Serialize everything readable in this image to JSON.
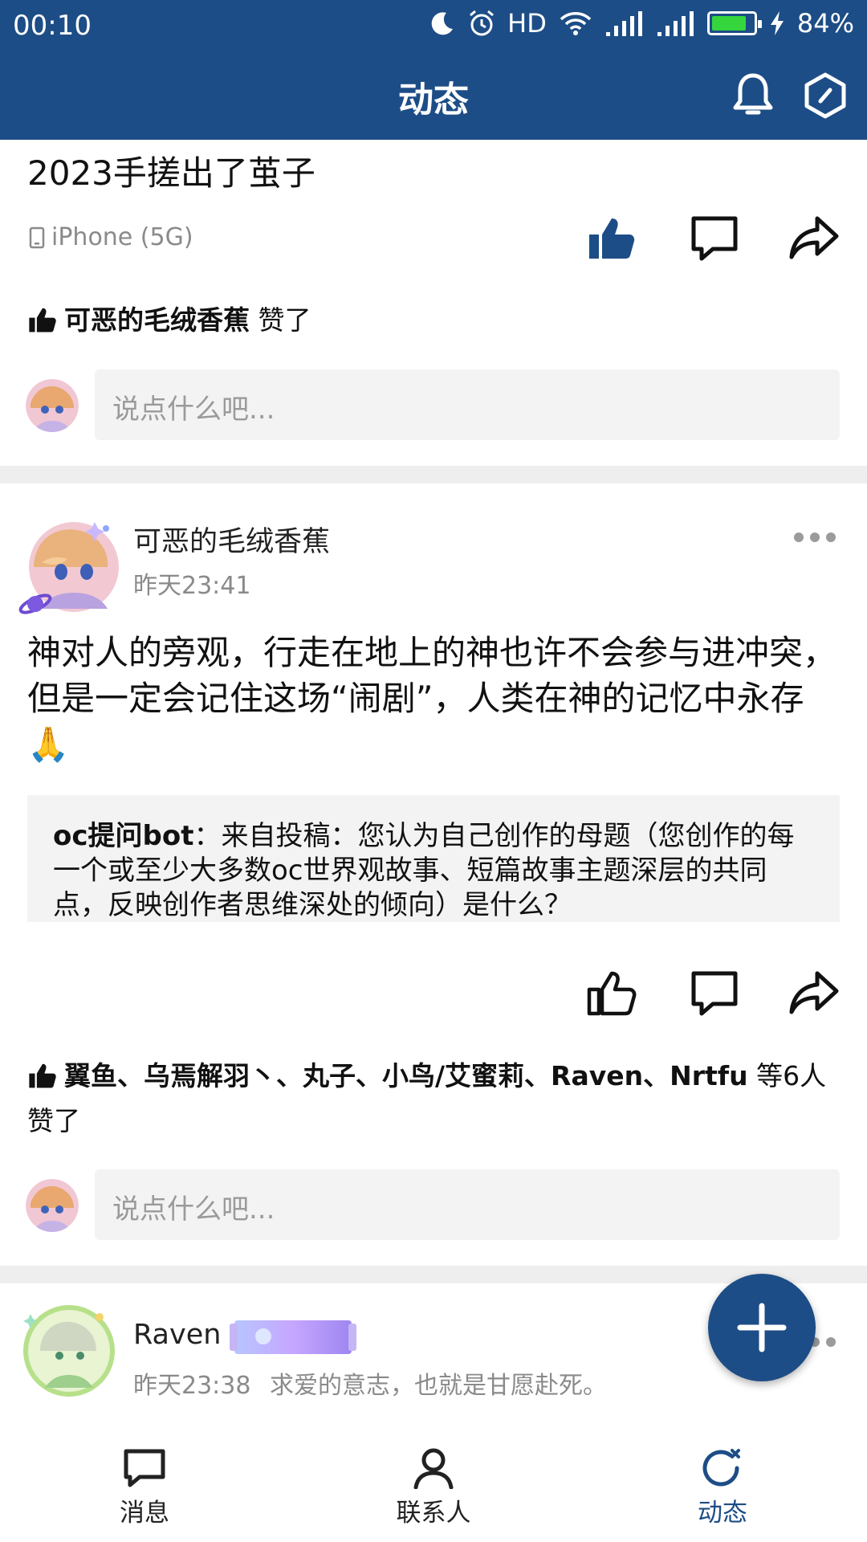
{
  "status_bar": {
    "time": "00:10",
    "network": "HD",
    "battery_percent": "84%",
    "battery_level": 0.84,
    "icons": [
      "moon-icon",
      "alarm-icon",
      "wifi-icon",
      "signal-icon",
      "signal-icon",
      "battery-icon",
      "charging-icon"
    ]
  },
  "header": {
    "title": "动态",
    "bell_icon": "bell-icon",
    "settings_icon": "hexagon-settings-icon"
  },
  "posts": [
    {
      "text": "2023手搓出了茧子",
      "device": "iPhone (5G)",
      "liked": true,
      "likes_names": "可恶的毛绒香蕉",
      "likes_suffix": " 赞了",
      "comment_placeholder": "说点什么吧..."
    },
    {
      "author": "可恶的毛绒香蕉",
      "time": "昨天23:41",
      "text": "神对人的旁观，行走在地上的神也许不会参与进冲突，但是一定会记住这场“闹剧”，人类在神的记忆中永存🙏",
      "quote_author": "oc提问bot",
      "quote_text": "：来自投稿：您认为自己创作的母题（您创作的每一个或至少大多数oc世界观故事、短篇故事主题深层的共同点，反映创作者思维深处的倾向）是什么？",
      "liked": false,
      "likes_names": "翼鱼、乌焉解羽丶、丸子、小鸟/艾蜜莉、Raven、Nrtfu",
      "likes_suffix": " 等6人赞了",
      "comment_placeholder": "说点什么吧..."
    },
    {
      "author": "Raven",
      "time": "昨天23:38",
      "signature": "求爱的意志，也就是甘愿赴死。"
    }
  ],
  "fab_icon": "plus-icon",
  "bottom_nav": [
    {
      "label": "消息",
      "icon": "message-icon",
      "active": false
    },
    {
      "label": "联系人",
      "icon": "contacts-icon",
      "active": false
    },
    {
      "label": "动态",
      "icon": "feed-refresh-icon",
      "active": true
    }
  ],
  "colors": {
    "brand": "#1d4d86",
    "battery": "#35d63d",
    "secondary_text": "#8a8a8a",
    "input_bg": "#f3f3f3"
  }
}
